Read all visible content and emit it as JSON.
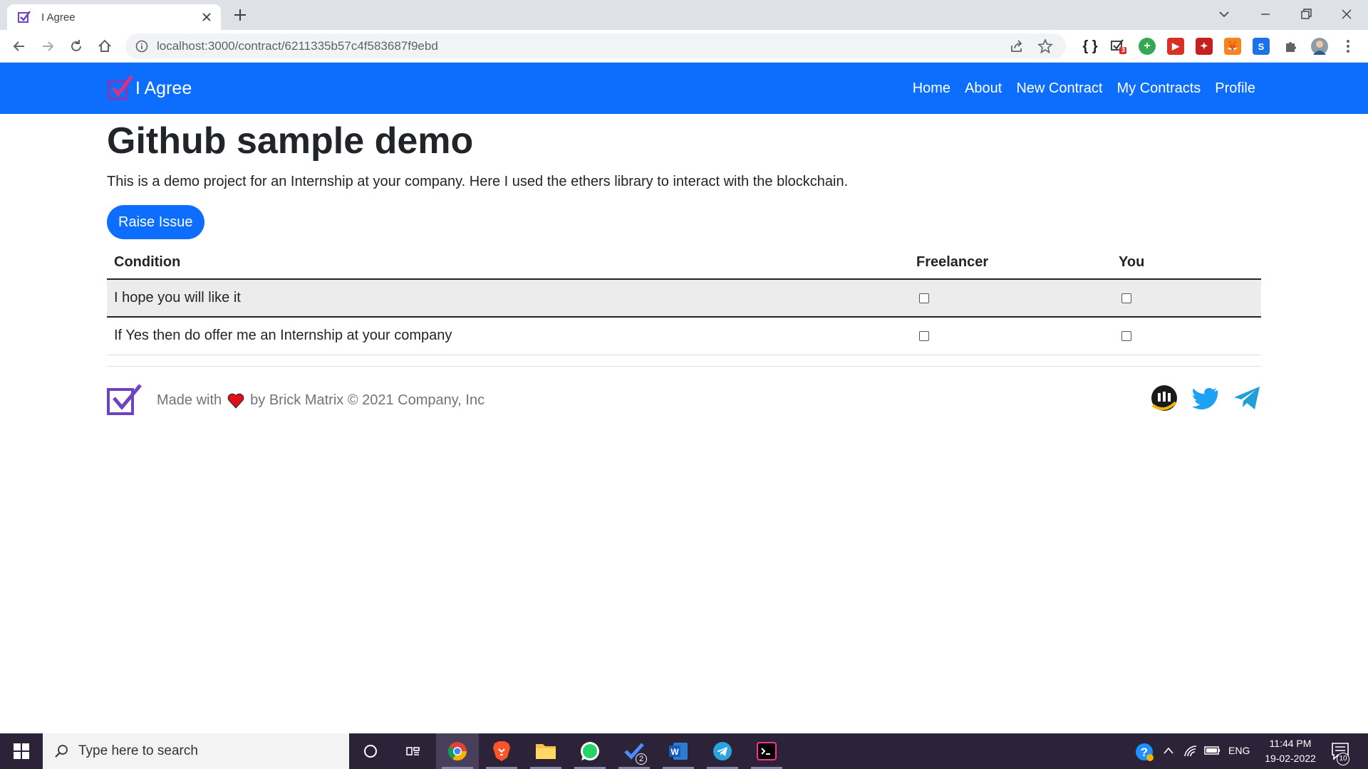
{
  "browser": {
    "tab_title": "I Agree",
    "url": "localhost:3000/contract/6211335b57c4f583687f9ebd",
    "extension_badge": "3"
  },
  "navbar": {
    "brand": "I Agree",
    "links": [
      "Home",
      "About",
      "New Contract",
      "My Contracts",
      "Profile"
    ]
  },
  "page": {
    "title": "Github sample demo",
    "description": "This is a demo project for an Internship at your company. Here I used the ethers library to interact with the blockchain.",
    "raise_button": "Raise Issue"
  },
  "table": {
    "headers": [
      "Condition",
      "Freelancer",
      "You"
    ],
    "rows": [
      {
        "condition": "I hope you will like it",
        "freelancer": false,
        "you": false
      },
      {
        "condition": "If Yes then do offer me an Internship at your company",
        "freelancer": false,
        "you": false
      }
    ]
  },
  "footer": {
    "made_with": "Made with",
    "by_text": "by Brick Matrix © 2021 Company, Inc"
  },
  "taskbar": {
    "search_placeholder": "Type here to search",
    "language": "ENG",
    "time": "11:44 PM",
    "date": "19-02-2022",
    "notification_count": "10",
    "todo_badge": "2"
  },
  "colors": {
    "primary": "#0d6efd",
    "logo_purple": "#6f42c1",
    "twitter": "#1da1f2",
    "telegram": "#229ed9"
  }
}
